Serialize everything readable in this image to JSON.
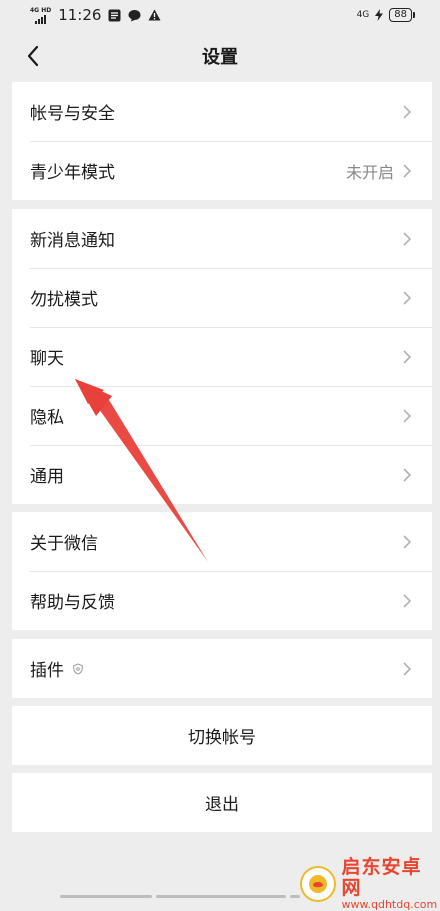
{
  "status_bar": {
    "network_type": "4G HD",
    "time": "11:26",
    "right_network": "4G",
    "battery": "88"
  },
  "nav": {
    "title": "设置"
  },
  "groups": [
    {
      "items": [
        {
          "label": "帐号与安全"
        },
        {
          "label": "青少年模式",
          "value": "未开启"
        }
      ]
    },
    {
      "items": [
        {
          "label": "新消息通知"
        },
        {
          "label": "勿扰模式"
        },
        {
          "label": "聊天"
        },
        {
          "label": "隐私"
        },
        {
          "label": "通用"
        }
      ]
    },
    {
      "items": [
        {
          "label": "关于微信"
        },
        {
          "label": "帮助与反馈"
        }
      ]
    },
    {
      "items": [
        {
          "label": "插件"
        }
      ]
    }
  ],
  "actions": {
    "switch_account": "切换帐号",
    "logout": "退出"
  },
  "watermark": {
    "title": "启东安卓网",
    "url": "www.qdhtdq.com"
  },
  "colors": {
    "background": "#ededed",
    "card": "#ffffff",
    "annotation_arrow": "#e8403a",
    "watermark": "#e8462f"
  }
}
